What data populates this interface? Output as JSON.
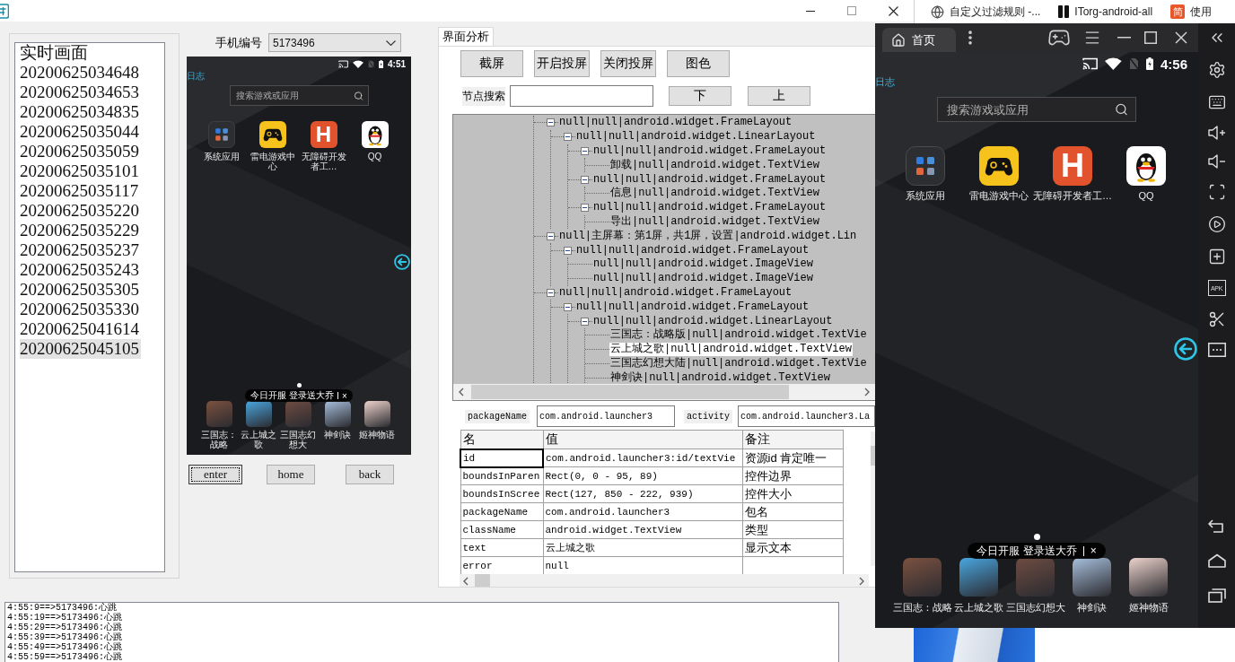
{
  "snapshot_list": {
    "items": [
      {
        "label": "实时画面",
        "selected": false
      },
      {
        "label": "20200625034648",
        "selected": false
      },
      {
        "label": "20200625034653",
        "selected": false
      },
      {
        "label": "20200625034835",
        "selected": false
      },
      {
        "label": "20200625035044",
        "selected": false
      },
      {
        "label": "20200625035059",
        "selected": false
      },
      {
        "label": "20200625035101",
        "selected": false
      },
      {
        "label": "20200625035117",
        "selected": false
      },
      {
        "label": "20200625035220",
        "selected": false
      },
      {
        "label": "20200625035229",
        "selected": false
      },
      {
        "label": "20200625035237",
        "selected": false
      },
      {
        "label": "20200625035243",
        "selected": false
      },
      {
        "label": "20200625035305",
        "selected": false
      },
      {
        "label": "20200625035330",
        "selected": false
      },
      {
        "label": "20200625041614",
        "selected": false
      },
      {
        "label": "20200625045105",
        "selected": true
      }
    ]
  },
  "phone_picker": {
    "label": "手机编号",
    "value": "5173496"
  },
  "preview_screen": {
    "time": "4:51",
    "log_link": "日志",
    "search_placeholder": "搜索游戏或应用",
    "apps": [
      {
        "label": "系统应用",
        "kind": "folder"
      },
      {
        "label": "雷电游戏中心",
        "kind": "gamepad"
      },
      {
        "label": "无障碍开发者工…",
        "kind": "letter",
        "letter": "H"
      },
      {
        "label": "QQ",
        "kind": "penguin"
      }
    ],
    "promo": "今日开服 登录送大乔",
    "promo_close": "×",
    "games": [
      {
        "label": "三国志：战略"
      },
      {
        "label": "云上城之歌"
      },
      {
        "label": "三国志幻想大"
      },
      {
        "label": "神剑诀"
      },
      {
        "label": "姬神物语"
      }
    ]
  },
  "device_buttons": [
    {
      "label": "enter",
      "focused": true
    },
    {
      "label": "home",
      "focused": false
    },
    {
      "label": "back",
      "focused": false
    }
  ],
  "analysis": {
    "tabs": [
      {
        "label": "界面分析",
        "selected": true
      }
    ],
    "actions": [
      "截屏",
      "开启投屏",
      "关闭投屏",
      "图色"
    ],
    "node_search": {
      "label": "节点搜索"
    },
    "nav_buttons": [
      "下",
      "上"
    ],
    "tree": {
      "nodes": [
        {
          "label": "null|null|android.widget.FrameLayout",
          "expanded": true,
          "selected": false,
          "children": [
            {
              "label": "null|null|android.widget.LinearLayout",
              "expanded": true,
              "selected": false,
              "children": [
                {
                  "label": "null|null|android.widget.FrameLayout",
                  "expanded": true,
                  "selected": false,
                  "children": [
                    {
                      "label": "卸载|null|android.widget.TextView",
                      "selected": false
                    }
                  ]
                },
                {
                  "label": "null|null|android.widget.FrameLayout",
                  "expanded": true,
                  "selected": false,
                  "children": [
                    {
                      "label": "信息|null|android.widget.TextView",
                      "selected": false
                    }
                  ]
                },
                {
                  "label": "null|null|android.widget.FrameLayout",
                  "expanded": true,
                  "selected": false,
                  "children": [
                    {
                      "label": "导出|null|android.widget.TextView",
                      "selected": false
                    }
                  ]
                }
              ]
            }
          ]
        },
        {
          "label": "null|主屏幕：第1屏，共1屏，设置|android.widget.Lin",
          "expanded": true,
          "selected": false,
          "children": [
            {
              "label": "null|null|android.widget.FrameLayout",
              "expanded": true,
              "selected": false,
              "children": [
                {
                  "label": "null|null|android.widget.ImageView",
                  "selected": false
                },
                {
                  "label": "null|null|android.widget.ImageView",
                  "selected": false
                }
              ]
            }
          ]
        },
        {
          "label": "null|null|android.widget.FrameLayout",
          "expanded": true,
          "selected": false,
          "children": [
            {
              "label": "null|null|android.widget.FrameLayout",
              "expanded": true,
              "selected": false,
              "children": [
                {
                  "label": "null|null|android.widget.LinearLayout",
                  "expanded": true,
                  "selected": false,
                  "children": [
                    {
                      "label": "三国志：战略版|null|android.widget.TextVie",
                      "selected": false
                    },
                    {
                      "label": "云上城之歌|null|android.widget.TextView",
                      "selected": true
                    },
                    {
                      "label": "三国志幻想大陆|null|android.widget.TextVie",
                      "selected": false
                    },
                    {
                      "label": "神剑诀|null|android.widget.TextView",
                      "selected": false
                    }
                  ]
                }
              ]
            }
          ]
        }
      ]
    },
    "package_name": {
      "label": "packageName",
      "value": "com.android.launcher3"
    },
    "activity": {
      "label": "activity",
      "value": "com.android.launcher3.La"
    },
    "properties": {
      "columns": [
        "名",
        "值",
        "备注"
      ],
      "rows": [
        {
          "cells": [
            "id",
            "com.android.launcher3:id/textVie",
            "资源id 肯定唯一"
          ],
          "selected": true
        },
        {
          "cells": [
            "boundsInParen",
            "Rect(0, 0 - 95, 89)",
            "控件边界"
          ],
          "selected": false
        },
        {
          "cells": [
            "boundsInScree",
            "Rect(127, 850 - 222, 939)",
            "控件大小"
          ],
          "selected": false
        },
        {
          "cells": [
            "packageName",
            "com.android.launcher3",
            "包名"
          ],
          "selected": false
        },
        {
          "cells": [
            "className",
            "android.widget.TextView",
            "类型"
          ],
          "selected": false
        },
        {
          "cells": [
            "text",
            "云上城之歌",
            "显示文本"
          ],
          "selected": false
        },
        {
          "cells": [
            "error",
            "null"
          ],
          "selected": false
        }
      ]
    }
  },
  "log": {
    "lines": [
      "4:55:9==>5173496:心跳",
      "4:55:19==>5173496:心跳",
      "4:55:29==>5173496:心跳",
      "4:55:39==>5173496:心跳",
      "4:55:49==>5173496:心跳",
      "4:55:59==>5173496:心跳"
    ]
  },
  "bookmarks": [
    {
      "title": "自定义过滤规则 -...",
      "kind": "globe"
    },
    {
      "title": "ITorg-android-all",
      "kind": "book"
    },
    {
      "title": "使用",
      "kind": "badge",
      "badge": "简"
    }
  ],
  "emulator": {
    "tabs": [
      {
        "label": "首页",
        "selected": true
      }
    ],
    "apk_label": "APK",
    "screen": {
      "time": "4:56",
      "log_link": "日志",
      "search_placeholder": "搜索游戏或应用",
      "apps": [
        {
          "label": "系统应用",
          "kind": "folder"
        },
        {
          "label": "雷电游戏中心",
          "kind": "gamepad"
        },
        {
          "label": "无障碍开发者工…",
          "kind": "letter",
          "letter": "H"
        },
        {
          "label": "QQ",
          "kind": "penguin"
        }
      ],
      "promo": "今日开服 登录送大乔",
      "promo_close": "×",
      "games": [
        {
          "label": "三国志：战略"
        },
        {
          "label": "云上城之歌"
        },
        {
          "label": "三国志幻想大"
        },
        {
          "label": "神剑诀"
        },
        {
          "label": "姬神物语"
        }
      ]
    }
  }
}
